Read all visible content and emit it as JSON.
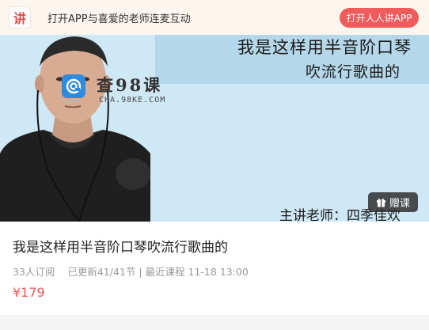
{
  "topbar": {
    "logo_text": "讲",
    "promo_text": "打开APP与喜爱的老师连麦互动",
    "open_app_label": "打开人人讲APP"
  },
  "cover": {
    "title_line1": "我是这样用半音阶口琴",
    "title_line2": "吹流行歌曲的",
    "teacher_line": "主讲老师：四季佳欢",
    "watermark_main": "查98课",
    "watermark_sub": "CHA.98KE.COM",
    "gift_label": "赠课"
  },
  "course": {
    "title": "我是这样用半音阶口琴吹流行歌曲的",
    "subscribers": "33人订阅",
    "updated": "已更新41/41节",
    "latest": "| 最近课程 11-18 13:00",
    "price": "¥179"
  },
  "colors": {
    "accent": "#f05b5b",
    "cover_bg": "#cfe8f6",
    "banner_bg": "#fdf6ee"
  }
}
